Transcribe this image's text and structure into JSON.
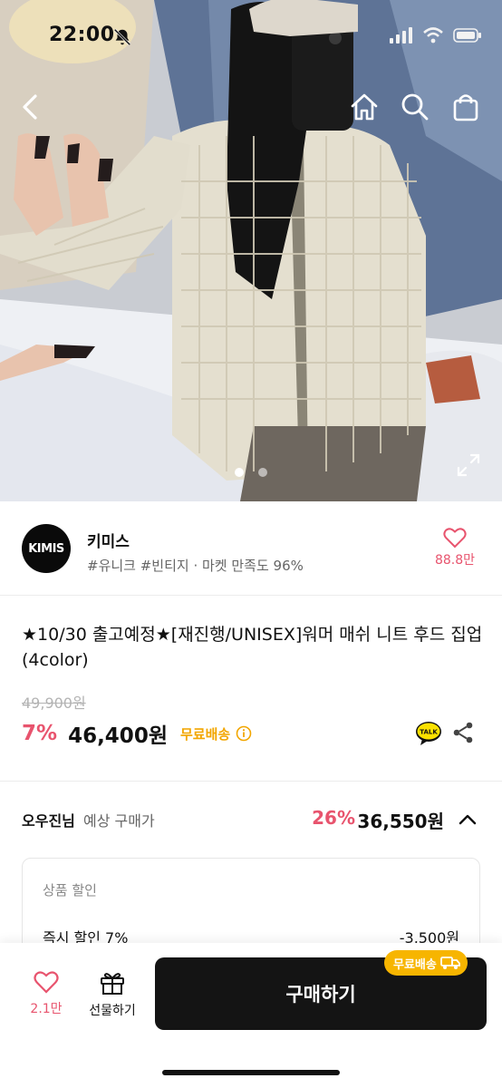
{
  "status_bar": {
    "time": "22:00"
  },
  "hero": {
    "icons": [
      "back-icon",
      "home-icon",
      "search-icon",
      "shopping-bag-icon",
      "expand-icon"
    ],
    "page_indicator": {
      "current": 1,
      "total": 2
    }
  },
  "seller": {
    "logo_text": "KIMIS",
    "name": "키미스",
    "meta": "#유니크 #빈티지 · 마켓 만족도 96%",
    "likes": "88.8만"
  },
  "product": {
    "title": "★10/30 출고예정★[재진행/UNISEX]워머 매쉬 니트 후드 집업(4color)",
    "original_price": "49,900원",
    "discount": "7%",
    "price": "46,400원",
    "shipping": "무료배송",
    "talk_label": "TALK"
  },
  "expected": {
    "user": "오우진님",
    "label": "예상 구매가",
    "discount": "26%",
    "price": "36,550원",
    "detail_header": "상품 할인",
    "detail_label": "즉시 할인 7%",
    "detail_value": "-3,500원"
  },
  "bottom_bar": {
    "like_count": "2.1만",
    "gift_label": "선물하기",
    "buy_label": "구매하기",
    "ship_badge": "무료배송"
  },
  "colors": {
    "accent": "#e8546e",
    "shipping": "#f2a600",
    "badge": "#f7b500",
    "button": "#141414"
  }
}
